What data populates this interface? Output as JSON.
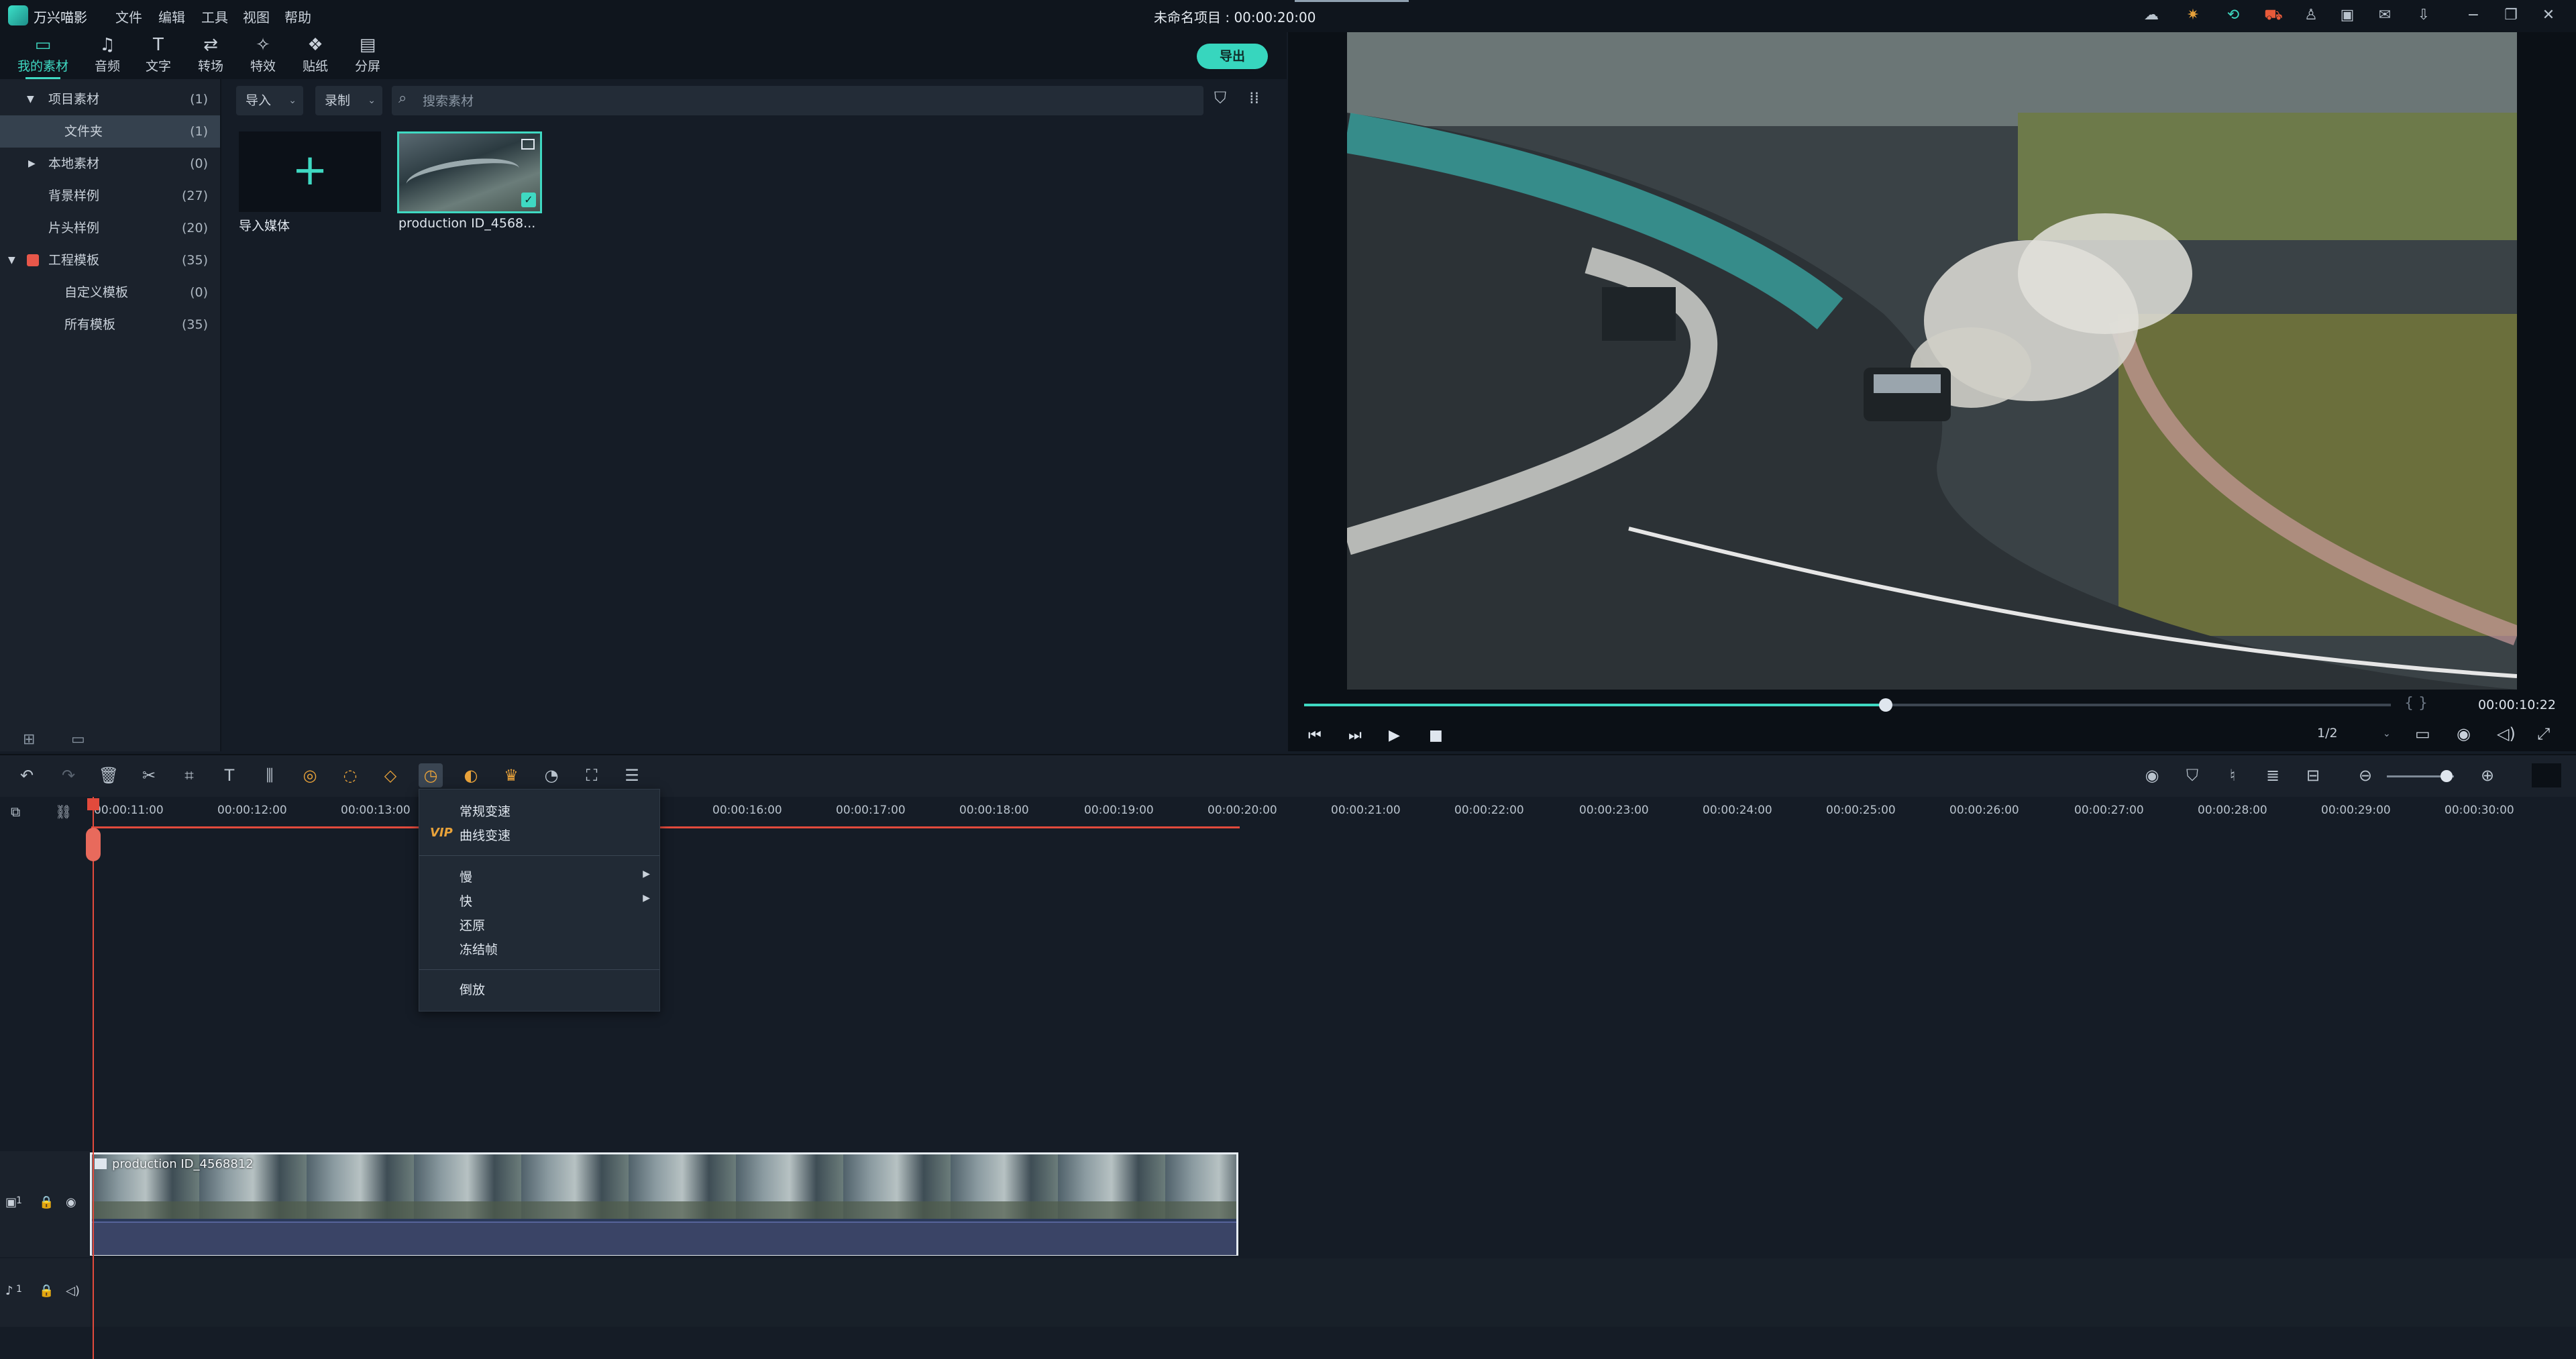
{
  "app": {
    "name": "万兴喵影",
    "project_title": "未命名项目 : 00:00:20:00"
  },
  "menu": [
    "文件",
    "编辑",
    "工具",
    "视图",
    "帮助"
  ],
  "tabs": [
    {
      "label": "我的素材",
      "icon": "folder-icon",
      "active": true
    },
    {
      "label": "音频",
      "icon": "music-icon"
    },
    {
      "label": "文字",
      "icon": "text-icon"
    },
    {
      "label": "转场",
      "icon": "transition-icon"
    },
    {
      "label": "特效",
      "icon": "effects-icon"
    },
    {
      "label": "贴纸",
      "icon": "sticker-icon"
    },
    {
      "label": "分屏",
      "icon": "split-screen-icon"
    }
  ],
  "export_label": "导出",
  "tree": [
    {
      "name": "项目素材",
      "count": "(1)",
      "expanded": true
    },
    {
      "name": "文件夹",
      "count": "(1)",
      "selected": true
    },
    {
      "name": "本地素材",
      "count": "(0)",
      "expanded": false
    },
    {
      "name": "背景样例",
      "count": "(27)"
    },
    {
      "name": "片头样例",
      "count": "(20)"
    },
    {
      "name": "工程模板",
      "count": "(35)",
      "expanded": true
    },
    {
      "name": "自定义模板",
      "count": "(0)"
    },
    {
      "name": "所有模板",
      "count": "(35)"
    }
  ],
  "media_toolbar": {
    "import": "导入",
    "record": "录制",
    "search_placeholder": "搜索素材"
  },
  "media_items": [
    {
      "label": "导入媒体",
      "type": "import"
    },
    {
      "label": "production ID_4568...",
      "type": "clip",
      "selected": true
    }
  ],
  "preview": {
    "timecode": "00:00:10:22",
    "progress": 0.535,
    "ratio": "1/2",
    "brackets": "{ }"
  },
  "timeline": {
    "ruler": [
      "00:00:11:00",
      "00:00:12:00",
      "00:00:13:00",
      "00:00:16:00",
      "00:00:17:00",
      "00:00:18:00",
      "00:00:19:00",
      "00:00:20:00",
      "00:00:21:00",
      "00:00:22:00",
      "00:00:23:00",
      "00:00:24:00",
      "00:00:25:00",
      "00:00:26:00",
      "00:00:27:00",
      "00:00:28:00",
      "00:00:29:00",
      "00:00:30:00"
    ],
    "clip_name": "production ID_4568812",
    "video_track": "1",
    "audio_track": "1"
  },
  "speed_menu": {
    "normal": "常规变速",
    "vip_badge": "VIP",
    "curve": "曲线变速",
    "slow": "慢",
    "fast": "快",
    "reset": "还原",
    "freeze": "冻结帧",
    "reverse": "倒放"
  },
  "colors": {
    "accent": "#3fd9c2",
    "playhead": "#e24a3c",
    "bg": "#151c26"
  }
}
